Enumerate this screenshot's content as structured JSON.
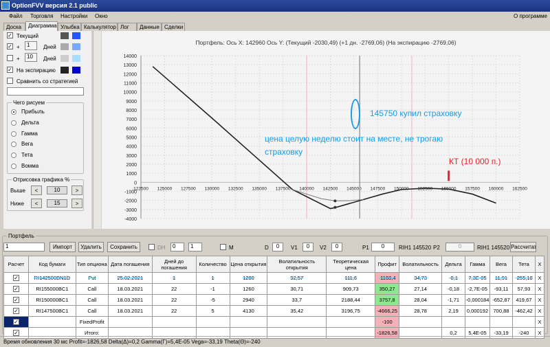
{
  "window": {
    "title": "OptionFVV версия 2.1 public"
  },
  "menu": {
    "items": [
      "Файл",
      "Торговля",
      "Настройки",
      "Окно"
    ],
    "about": "О программе"
  },
  "tabs": [
    "Доска",
    "Диаграмма",
    "Улыбка",
    "Калькулятор",
    "Лог",
    "Данные",
    "Сделки"
  ],
  "left": {
    "current_label": "Текущий",
    "plus": "+",
    "days": "Дней",
    "plus1_value": "1",
    "plus10_value": "10",
    "expiration_label": "На экспирацию",
    "compare_label": "Сравнить со стратегией",
    "draw_group": "Чего рисуем",
    "draw_options": [
      "Прибыль",
      "Дельта",
      "Гамма",
      "Вега",
      "Тета",
      "Вомма"
    ],
    "range_group": "Отрисовка графика %",
    "above": "Выше",
    "below": "Ниже",
    "above_value": "10",
    "below_value": "15",
    "lt": "<",
    "gt": ">",
    "colors": {
      "current": [
        "#555555",
        "#2255ff"
      ],
      "plus1": [
        "#aaaaaa",
        "#77aaff"
      ],
      "plus10": [
        "#cccccc",
        "#aaddff"
      ],
      "exp": [
        "#222222",
        "#0000cc"
      ]
    }
  },
  "chart_data": {
    "type": "line",
    "title": "Портфель: Ось X: 142960 Ось Y:  (Текущий -2030,49)  (+1 дн. -2769,06)  (На экспирацию -2769,06)",
    "xlim": [
      122500,
      162500
    ],
    "ylim": [
      -4000,
      14000
    ],
    "xticks": [
      122500,
      125000,
      127500,
      130000,
      132500,
      135000,
      137500,
      140000,
      142500,
      145000,
      147500,
      150000,
      152500,
      155000,
      157500,
      160000,
      162500
    ],
    "yticks": [
      14000,
      13000,
      12000,
      11000,
      10000,
      9000,
      8000,
      7000,
      6000,
      5000,
      4000,
      3000,
      2000,
      1000,
      0,
      -1000,
      -2000,
      -3000,
      -4000
    ],
    "series": [
      {
        "name": "На экспирацию",
        "color": "#222222",
        "x": [
          123750,
          130000,
          135000,
          138500,
          142500,
          143000,
          146000,
          148000,
          150000,
          152500,
          155000,
          157500,
          160000
        ],
        "y": [
          12800,
          7100,
          2450,
          -800,
          -2900,
          -2800,
          -1900,
          -1300,
          -800,
          -650,
          -750,
          -1300,
          -2300
        ]
      },
      {
        "name": "Текущий",
        "color": "#777777",
        "x": [
          138500,
          140000,
          141500,
          143000,
          144500,
          146000
        ],
        "y": [
          -800,
          -1300,
          -1800,
          -2050,
          -2030,
          -1900
        ]
      }
    ],
    "markers": [
      {
        "x": 143000,
        "y": -2050
      },
      {
        "x": 143000,
        "y": -2769
      }
    ],
    "vlines": {
      "red": [
        140000,
        151100
      ],
      "grey": [
        145600
      ]
    },
    "annotations": {
      "note1": "145750 купил страховку",
      "note2": "цена целую неделю стоит на месте, не трогаю страховку",
      "kt": "КТ (10 000 п.)",
      "kt_x": 155000
    }
  },
  "portfolio": {
    "label": "Портфель",
    "select": "1",
    "import": "Импорт",
    "delete": "Удалить",
    "save": "Сохранить",
    "dh": "DH",
    "dh1": "0",
    "dh2": "1",
    "m": "M",
    "d_label": "D",
    "d": "0",
    "v1_label": "V1",
    "v1": "0",
    "v2_label": "V2",
    "v2": "0",
    "p1_label": "P1",
    "p1": "0",
    "rih1": "RIH1 145520",
    "p2_label": "P2",
    "p2": "0",
    "rih2": "RIH1 145520",
    "calc": "Рассчитать",
    "headers": [
      "Расчет",
      "Код бумаги",
      "Тип опциона",
      "Дата погашения",
      "Дней до погашения",
      "Количество",
      "Цена открытия",
      "Волатильность открытия",
      "Теоретическая цена",
      "Профит",
      "Волатильность",
      "Дельта",
      "Гамма",
      "Вега",
      "Тета",
      "X"
    ],
    "rows": [
      [
        "RI142500BN1D",
        "Put",
        "25.02.2021",
        "1",
        "1",
        "1280",
        "92,57",
        "111,6",
        "-1168,4",
        "34,73",
        "-0,1",
        "7,3E-05",
        "11,91",
        "-255,18"
      ],
      [
        "RI155000BC1",
        "Call",
        "18.03.2021",
        "22",
        "-1",
        "1260",
        "30,71",
        "909,73",
        "350,27",
        "27,14",
        "-0,18",
        "-2,7E-05",
        "-93,11",
        "57,93"
      ],
      [
        "RI150000BC1",
        "Call",
        "18.03.2021",
        "22",
        "-5",
        "2940",
        "33,7",
        "2188,44",
        "3757,8",
        "28,04",
        "-1,71",
        "-0,000184",
        "-652,87",
        "419,67"
      ],
      [
        "RI147500BC1",
        "Call",
        "18.03.2021",
        "22",
        "5",
        "4130",
        "35,42",
        "3196,75",
        "-4666,25",
        "28,78",
        "2,19",
        "0,000192",
        "700,88",
        "-462,42"
      ],
      [
        "",
        "FixedProfit",
        "",
        "",
        "",
        "",
        "",
        "",
        "-100",
        "",
        "",
        "",
        "",
        ""
      ],
      [
        "",
        "Итого:",
        "",
        "",
        "",
        "",
        "",
        "",
        "-1826,58",
        "",
        "0,2",
        "5,4E-05",
        "-33,19",
        "-240"
      ]
    ]
  },
  "status": "Время обновления 30 мс  Profit=-1826,58 Delta(Δ)=0,2 Gamma(Γ)=5,4E-05 Vega=-33,19 Theta(Θ)=-240"
}
